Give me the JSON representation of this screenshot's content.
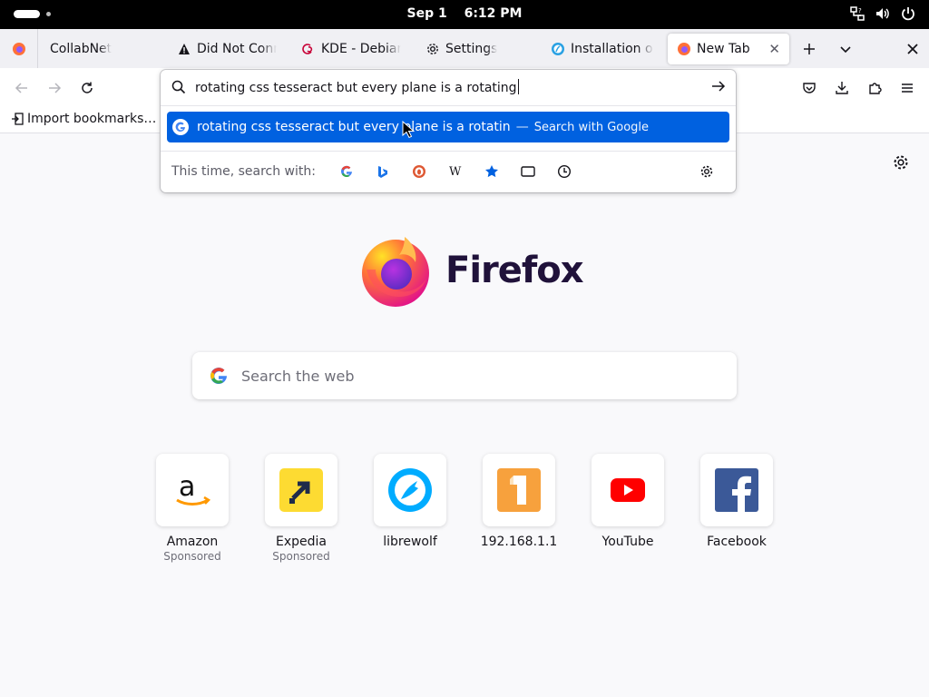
{
  "topbar": {
    "date": "Sep 1",
    "time": "6:12 PM",
    "tray_icons": [
      "network-icon",
      "volume-icon",
      "power-icon"
    ]
  },
  "tabs": [
    {
      "label": "CollabNet",
      "icon": "none",
      "active": false
    },
    {
      "label": "Did Not Connect: Potential Security Issue",
      "icon": "warning-icon",
      "active": false
    },
    {
      "label": "KDE - Debian Wiki",
      "icon": "debian-icon",
      "active": false
    },
    {
      "label": "Settings",
      "icon": "gear-icon",
      "active": false
    },
    {
      "label": "Installation on Linux",
      "icon": "globe-icon",
      "active": false
    },
    {
      "label": "New Tab",
      "icon": "firefox-icon",
      "active": true
    }
  ],
  "urlbar": {
    "query": "rotating css tesseract but every plane is a rotating",
    "suggestion_text": "rotating css tesseract but every plane is a rotatin",
    "suggestion_sep": "—",
    "suggestion_action": "Search with Google",
    "oneoff_label": "This time, search with:",
    "oneoff_engines": [
      "google-icon",
      "bing-icon",
      "duckduckgo-icon",
      "wikipedia-icon",
      "bookmarks-icon",
      "tabs-icon",
      "history-icon"
    ]
  },
  "bookmarks": {
    "import_label": "Import bookmarks…"
  },
  "newtab": {
    "wordmark": "Firefox",
    "search_placeholder": "Search the web",
    "top_sites": [
      {
        "name": "Amazon",
        "sponsored": "Sponsored"
      },
      {
        "name": "Expedia",
        "sponsored": "Sponsored"
      },
      {
        "name": "librewolf",
        "sponsored": ""
      },
      {
        "name": "192.168.1.1",
        "sponsored": ""
      },
      {
        "name": "YouTube",
        "sponsored": ""
      },
      {
        "name": "Facebook",
        "sponsored": ""
      }
    ]
  },
  "colors": {
    "accent": "#0061e0",
    "wordmark": "#20123a"
  }
}
